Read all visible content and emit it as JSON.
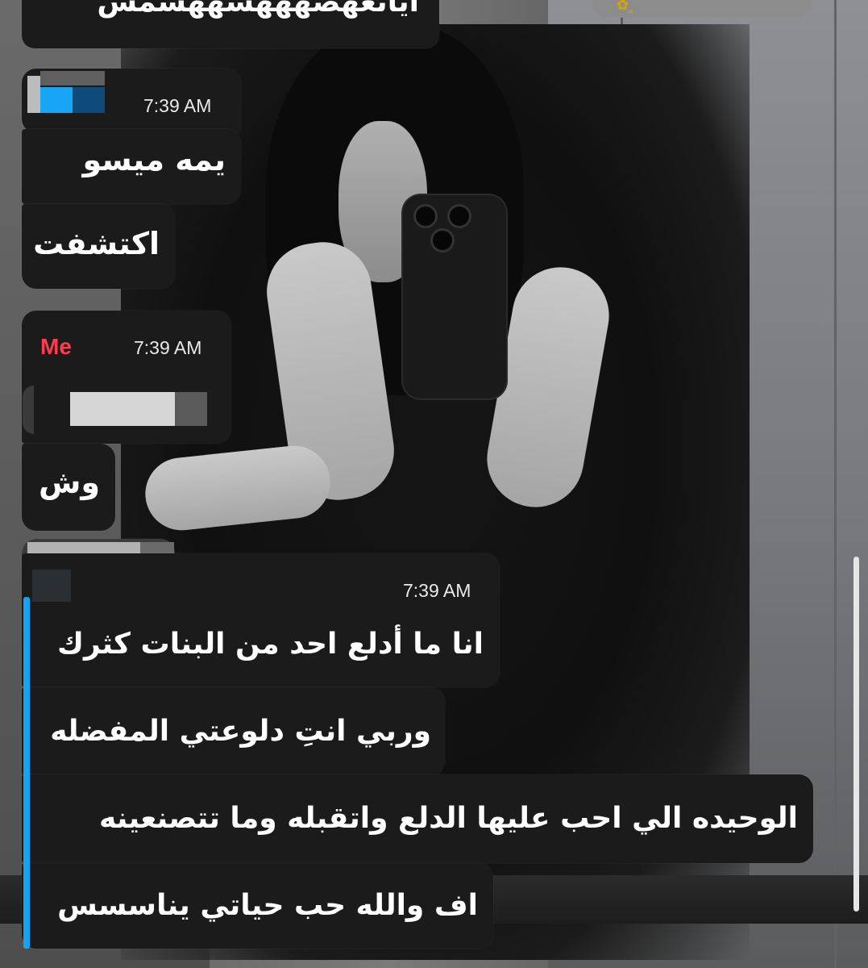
{
  "colors": {
    "bubble_bg": "#1b1b1b",
    "text": "#ffffff",
    "sender_me": "#ff3b4e",
    "reply_accent": "#18a2f2",
    "time_text": "#e9e9e9"
  },
  "messages": {
    "top_fragment": "أيانعهصهههشههشمس",
    "group1": {
      "time": "7:39 AM",
      "line1": "يمه ميسو",
      "line2": "اكتشفت"
    },
    "group2": {
      "sender": "Me",
      "time": "7:39 AM",
      "line1": "وش"
    },
    "group3": {
      "time": "7:39 AM",
      "line1": "انا ما أدلع احد من البنات كثرك",
      "line2": "وربي انتِ دلوعتي المفضله",
      "line3": "الوحيده الي احب عليها الدلع واتقبله وما تتصنعينه",
      "line4": "اف والله حب حياتي يناسسس"
    }
  },
  "icons": {
    "top_pill": "sticker-icons",
    "scroll": "scrollbar"
  }
}
